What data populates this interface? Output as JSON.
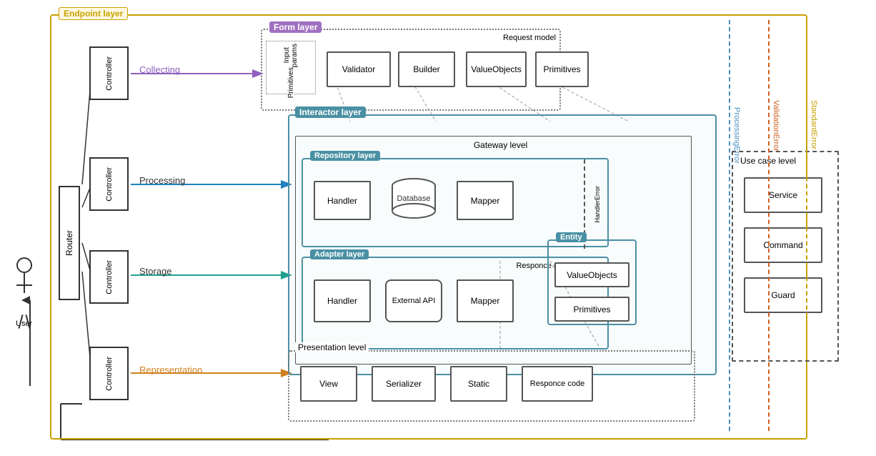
{
  "layers": {
    "endpoint": "Endpoint layer",
    "form": "Form layer",
    "interactor": "Interactor layer",
    "repository": "Repository layer",
    "adapter": "Adapter layer",
    "gateway": "Gateway level",
    "usecase": "Use case level",
    "presentation": "Presentation level",
    "responce_model": "Responce model",
    "request_model": "Request model"
  },
  "user": {
    "label": "User"
  },
  "router": "Router",
  "controllers": [
    "Controller",
    "Controller",
    "Controller",
    "Controller"
  ],
  "row_labels": [
    "Collecting",
    "Processing",
    "Storage",
    "Representation"
  ],
  "form_items": [
    "Validator",
    "Builder",
    "ValueObjects",
    "Primitives"
  ],
  "form_input": [
    "Input params",
    "Primitives"
  ],
  "repo_items": [
    "Handler",
    "Database",
    "Mapper"
  ],
  "adapter_items": [
    "Handler",
    "External API",
    "Mapper"
  ],
  "usecase_items": [
    "Service",
    "Command",
    "Guard"
  ],
  "presentation_items": [
    "View",
    "Serializer",
    "Static",
    "Responce code"
  ],
  "entity_label": "Entity",
  "entity_items": [
    "ValueObjects",
    "Primitives"
  ],
  "handler_error": "HandlerError",
  "errors": {
    "processing": "ProcessingError",
    "validation": "ValidationError",
    "standard": "StandardError"
  }
}
